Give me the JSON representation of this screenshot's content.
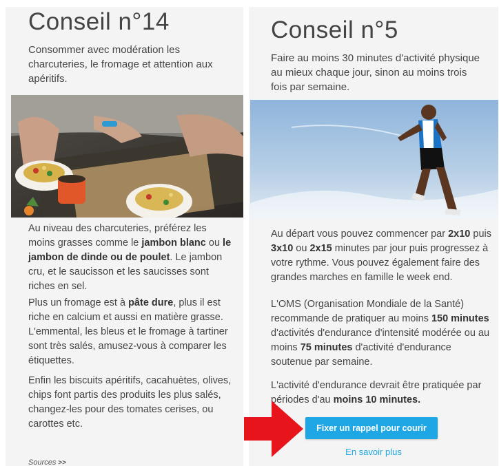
{
  "left": {
    "title": "Conseil n°14",
    "intro": [
      "Consommer avec modération les",
      "charcuteries, le fromage et attention aux",
      "apéritifs."
    ],
    "p1": {
      "a": "Au niveau des charcuteries, préférez les moins grasses comme le ",
      "b1": "jambon blanc",
      "c": " ou ",
      "b2": "le jambon de dinde ou de poulet",
      "d": ". Le jambon cru, et le saucisson et les saucisses sont riches en sel."
    },
    "p2": {
      "a": "Plus un fromage est à ",
      "b1": "pâte dure",
      "c": ", plus il est riche en calcium et aussi en matière grasse. L'emmental, les bleus et le fromage à tartiner sont très salés, amusez-vous à comparer les étiquettes."
    },
    "p3": "Enfin les biscuits apéritifs, cacahuètes, olives, chips font partis des produits les plus salés, changez-les pour des tomates cerises, ou carottes etc.",
    "sources_label": "Sources",
    "sources_chevron": ">>"
  },
  "right": {
    "title": "Conseil n°5",
    "intro": [
      "Faire au moins 30 minutes d'activité physique",
      "au mieux chaque jour, sinon au moins trois",
      "fois par semaine."
    ],
    "p1": {
      "a": "Au départ vous pouvez commencer par ",
      "b1": "2x10",
      "c": " puis ",
      "b2": "3x10",
      "d": " ou ",
      "b3": "2x15",
      "e": " minutes par jour puis progressez à votre rythme. Vous pouvez également faire des grandes marches en famille le week end."
    },
    "p2": {
      "a": "L'OMS (Organisation Mondiale de la Santé) recommande de pratiquer au moins ",
      "b1": "150 minutes",
      "c": " d'activités d'endurance d'intensité modérée ou au moins ",
      "b2": "75 minutes",
      "d": " d'activité d'endurance soutenue par semaine."
    },
    "p3": {
      "a": "L'activité d'endurance devrait être pratiquée par périodes d'au ",
      "b1": "moins 10 minutes."
    },
    "cta_label": "Fixer un rappel pour courir",
    "more_label": "En savoir plus"
  },
  "colors": {
    "accent": "#1ea7e4",
    "arrow": "#e8141b",
    "panel_bg": "#f4f4f4"
  },
  "icons": {
    "arrow": "red-right-arrow-icon"
  }
}
